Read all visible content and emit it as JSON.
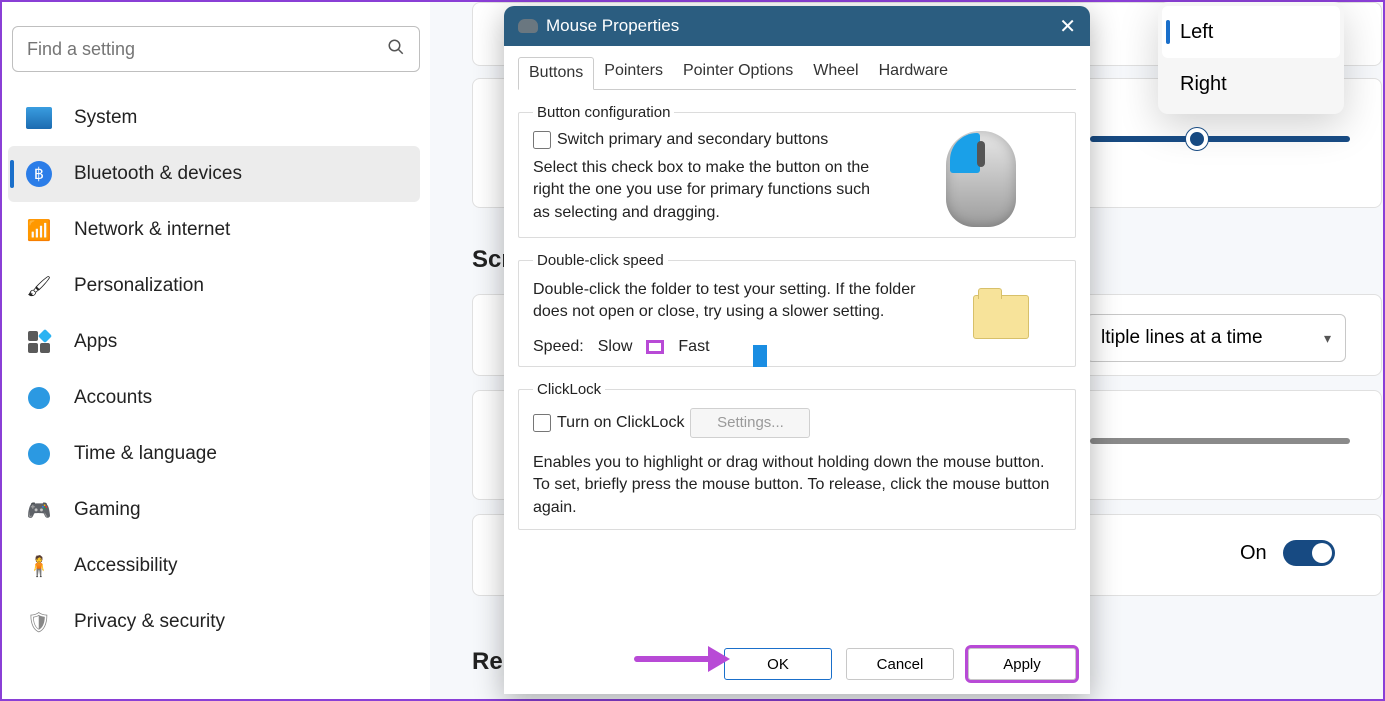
{
  "search": {
    "placeholder": "Find a setting"
  },
  "nav": [
    {
      "label": "System"
    },
    {
      "label": "Bluetooth & devices"
    },
    {
      "label": "Network & internet"
    },
    {
      "label": "Personalization"
    },
    {
      "label": "Apps"
    },
    {
      "label": "Accounts"
    },
    {
      "label": "Time & language"
    },
    {
      "label": "Gaming"
    },
    {
      "label": "Accessibility"
    },
    {
      "label": "Privacy & security"
    }
  ],
  "bg": {
    "scr_heading": "Scr",
    "re_heading": "Re",
    "dropdown_visible": "ltiple lines at a time",
    "on_label": "On",
    "menu": {
      "left": "Left",
      "right": "Right"
    }
  },
  "dialog": {
    "title": "Mouse Properties",
    "tabs": [
      "Buttons",
      "Pointers",
      "Pointer Options",
      "Wheel",
      "Hardware"
    ],
    "btncfg": {
      "legend": "Button configuration",
      "chk_label": "Switch primary and secondary buttons",
      "desc": "Select this check box to make the button on the right the one you use for primary functions such as selecting and dragging."
    },
    "dbl": {
      "legend": "Double-click speed",
      "desc": "Double-click the folder to test your setting. If the folder does not open or close, try using a slower setting.",
      "speed_label": "Speed:",
      "slow": "Slow",
      "fast": "Fast"
    },
    "clicklock": {
      "legend": "ClickLock",
      "chk_label": "Turn on ClickLock",
      "settings_btn": "Settings...",
      "desc": "Enables you to highlight or drag without holding down the mouse button. To set, briefly press the mouse button. To release, click the mouse button again."
    },
    "buttons": {
      "ok": "OK",
      "cancel": "Cancel",
      "apply": "Apply"
    }
  }
}
